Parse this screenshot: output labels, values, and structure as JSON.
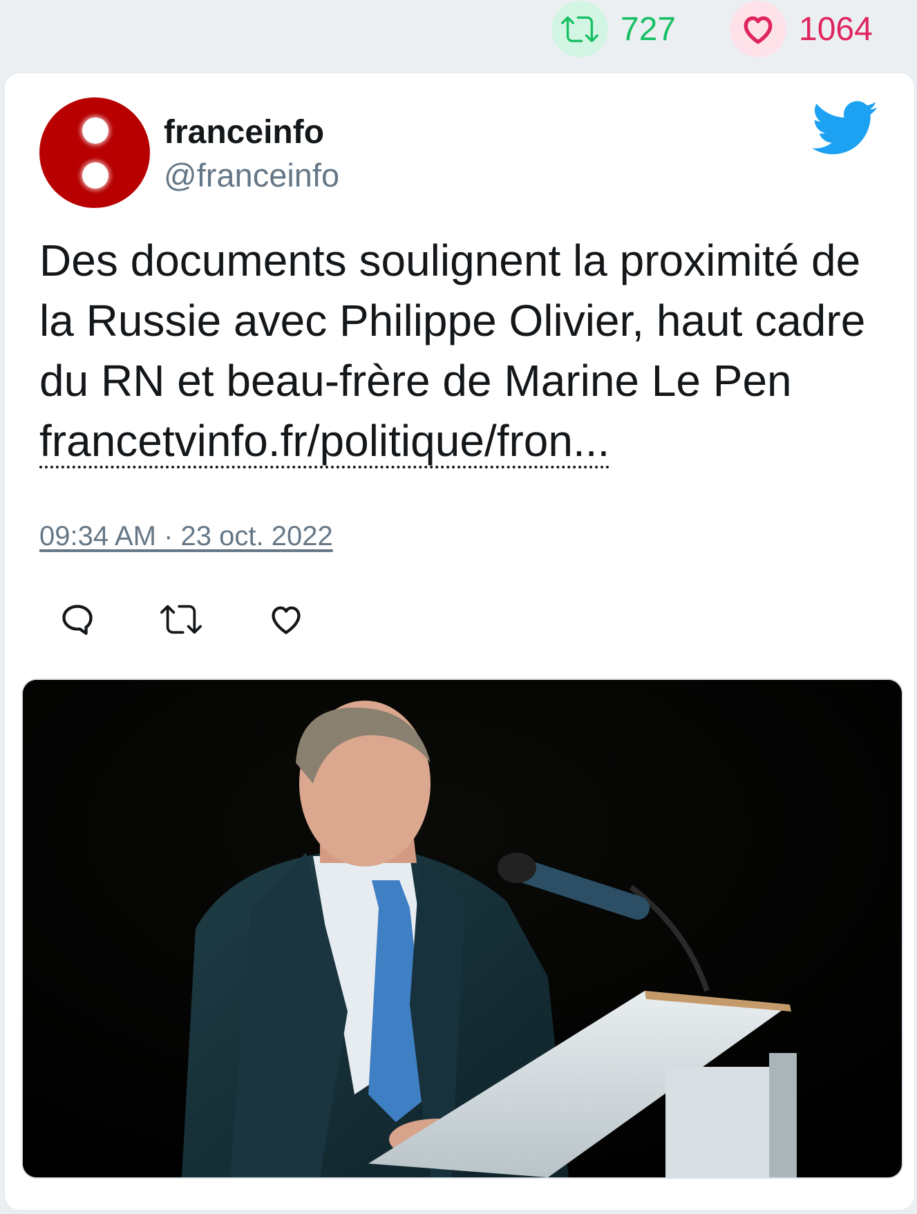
{
  "stats": {
    "retweets": "727",
    "likes": "1064",
    "retweet_color": "#17bf63",
    "like_color": "#e0245e"
  },
  "tweet": {
    "author_name": "franceinfo",
    "author_handle": "@franceinfo",
    "text": "Des documents soulignent la proximité de la Russie avec Philippe Olivier, haut cadre du RN et beau-frère de Marine Le Pen ",
    "link_text": "francetvinfo.fr/politique/fron...",
    "timestamp": "09:34 AM · 23 oct. 2022"
  },
  "icons": {
    "avatar": "franceinfo-logo",
    "brand": "twitter-bird-icon",
    "actions": [
      "reply-icon",
      "retweet-icon",
      "like-icon"
    ]
  },
  "colors": {
    "twitter_blue": "#1da1f2",
    "avatar_red": "#b80000"
  }
}
